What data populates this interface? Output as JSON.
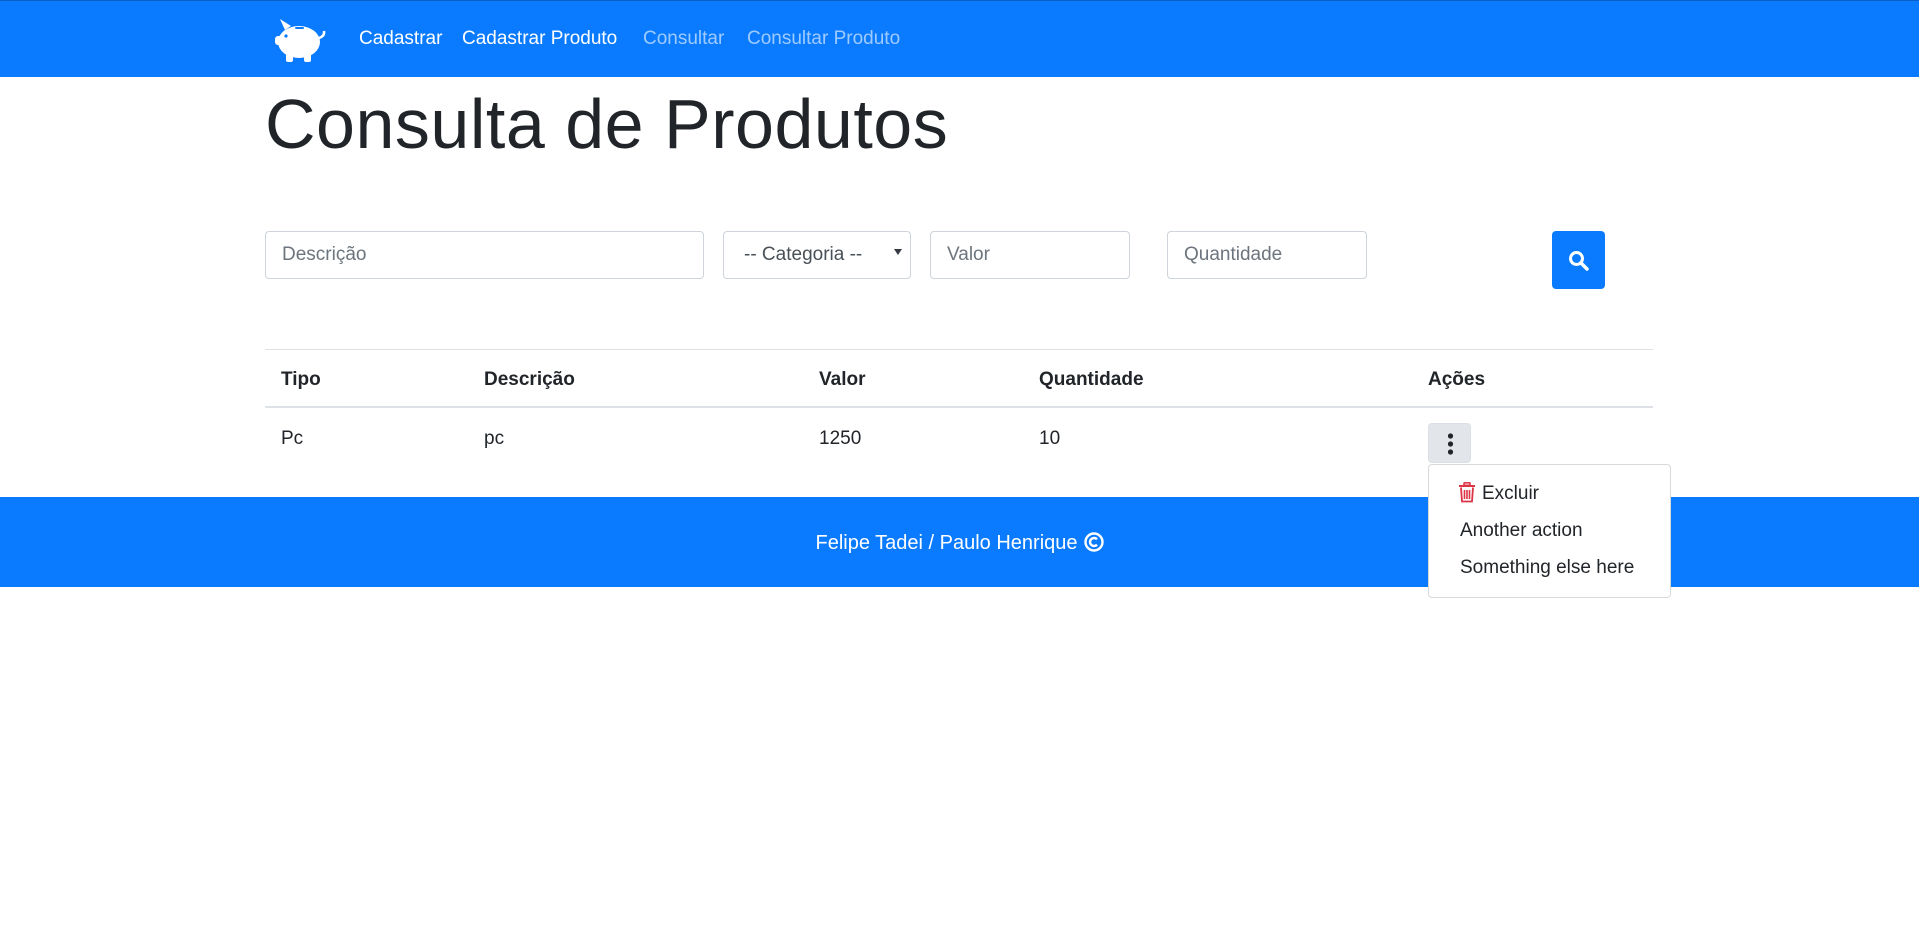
{
  "nav": {
    "logo_icon": "piggy-bank-icon",
    "links": [
      {
        "label": "Cadastrar",
        "active": true
      },
      {
        "label": "Cadastrar Produto",
        "active": true
      },
      {
        "label": "Consultar",
        "active": false
      },
      {
        "label": "Consultar Produto",
        "active": false
      }
    ]
  },
  "page": {
    "title": "Consulta de Produtos"
  },
  "filters": {
    "descricao_placeholder": "Descrição",
    "categoria_selected": "-- Categoria --",
    "valor_placeholder": "Valor",
    "quantidade_placeholder": "Quantidade",
    "search_icon": "search-icon"
  },
  "table": {
    "headers": [
      "Tipo",
      "Descrição",
      "Valor",
      "Quantidade",
      "Ações"
    ],
    "rows": [
      {
        "tipo": "Pc",
        "descricao": "pc",
        "valor": "1250",
        "quantidade": "10"
      }
    ]
  },
  "actions_menu": {
    "toggle_icon": "kebab-vertical-icon",
    "items": [
      {
        "label": "Excluir",
        "icon": "trash-icon"
      },
      {
        "label": "Another action"
      },
      {
        "label": "Something else here"
      }
    ]
  },
  "footer": {
    "text": "Felipe Tadei / Paulo Henrique",
    "icon": "copyright-icon"
  },
  "colors": {
    "primary": "#0a7bff",
    "danger": "#dc3545",
    "text": "#212529"
  }
}
